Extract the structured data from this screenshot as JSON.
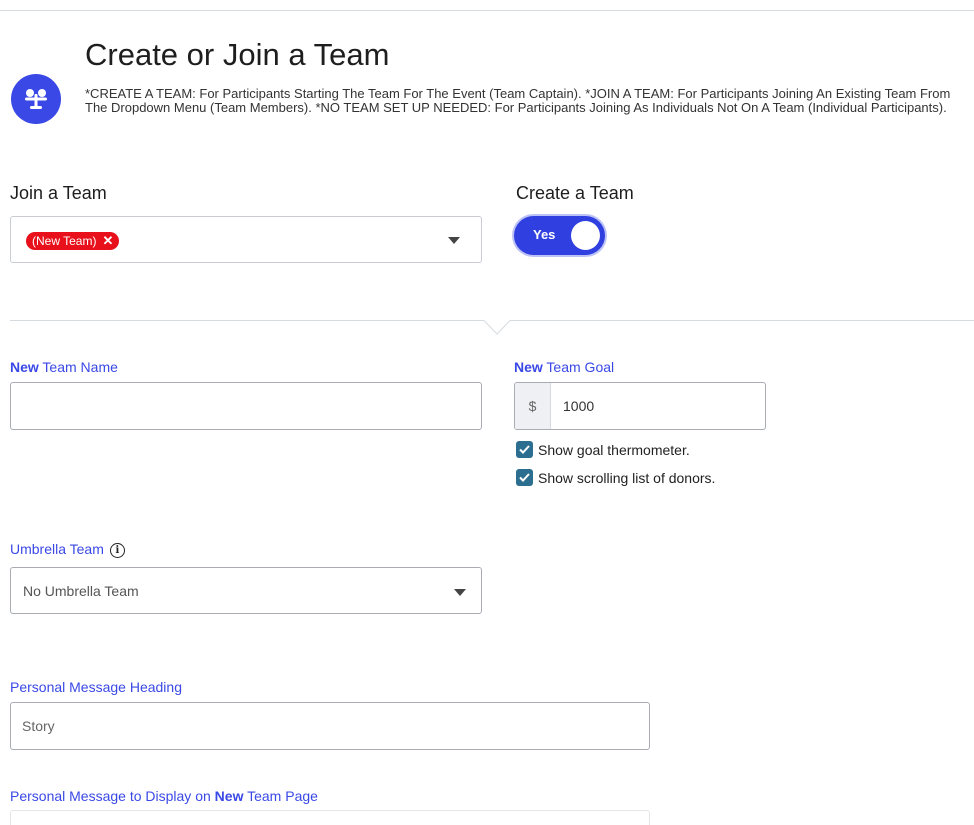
{
  "header": {
    "title": "Create or Join a Team",
    "description": "*CREATE A TEAM: For Participants Starting The Team For The Event (Team Captain). *JOIN A TEAM: For Participants Joining An Existing Team From The Dropdown Menu (Team Members). *NO TEAM SET UP NEEDED: For Participants Joining As Individuals Not On A Team (Individual Participants).",
    "icon": "team-icon"
  },
  "join_team": {
    "label": "Join a Team",
    "selected_tag": "(New Team)",
    "tag_remove": "✕"
  },
  "create_team": {
    "label": "Create a Team",
    "toggle_label": "Yes",
    "toggle_on": true
  },
  "new_team_name": {
    "label_bold": "New",
    "label_rest": " Team Name",
    "value": ""
  },
  "new_team_goal": {
    "label_bold": "New",
    "label_rest": " Team Goal",
    "currency": "$",
    "value": "1000"
  },
  "options": {
    "show_thermometer": "Show goal thermometer.",
    "show_donors": "Show scrolling list of donors."
  },
  "umbrella_team": {
    "label": "Umbrella Team",
    "info_glyph": "i",
    "value": "No Umbrella Team"
  },
  "personal_heading": {
    "label": "Personal Message Heading",
    "value": "Story"
  },
  "personal_message": {
    "label_pre": "Personal Message to Display on ",
    "label_bold": "New",
    "label_post": " Team Page"
  },
  "colors": {
    "accent": "#3a49e6",
    "tag": "#e8101b",
    "checkbox": "#2c6e8f"
  }
}
